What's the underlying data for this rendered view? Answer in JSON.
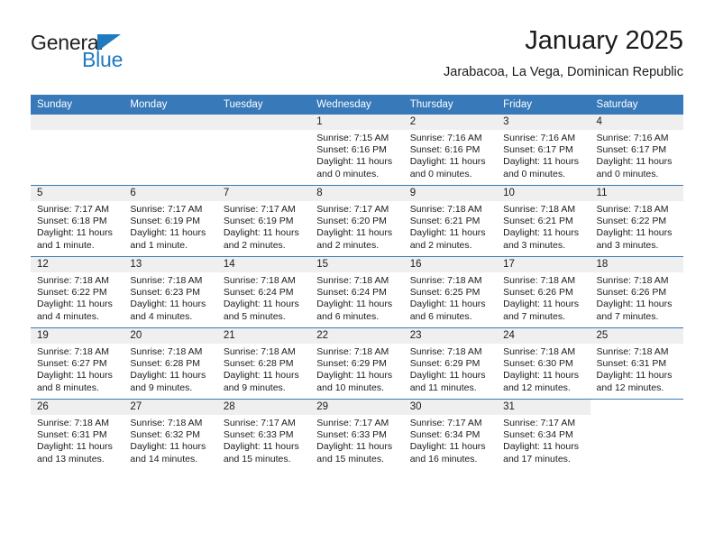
{
  "brand": {
    "name_top": "General",
    "name_bottom": "Blue",
    "accent_color": "#1f7ac0"
  },
  "header": {
    "title": "January 2025",
    "subtitle": "Jarabacoa, La Vega, Dominican Republic"
  },
  "calendar": {
    "header_bg": "#3779b9",
    "daynum_bg": "#efefef",
    "weekday_headers": [
      "Sunday",
      "Monday",
      "Tuesday",
      "Wednesday",
      "Thursday",
      "Friday",
      "Saturday"
    ],
    "labels": {
      "sunrise": "Sunrise:",
      "sunset": "Sunset:",
      "daylight": "Daylight:"
    },
    "weeks": [
      [
        {
          "day": "",
          "empty": true
        },
        {
          "day": "",
          "empty": true
        },
        {
          "day": "",
          "empty": true
        },
        {
          "day": "1",
          "sunrise": "Sunrise: 7:15 AM",
          "sunset": "Sunset: 6:16 PM",
          "daylight_line1": "Daylight: 11 hours",
          "daylight_line2": "and 0 minutes."
        },
        {
          "day": "2",
          "sunrise": "Sunrise: 7:16 AM",
          "sunset": "Sunset: 6:16 PM",
          "daylight_line1": "Daylight: 11 hours",
          "daylight_line2": "and 0 minutes."
        },
        {
          "day": "3",
          "sunrise": "Sunrise: 7:16 AM",
          "sunset": "Sunset: 6:17 PM",
          "daylight_line1": "Daylight: 11 hours",
          "daylight_line2": "and 0 minutes."
        },
        {
          "day": "4",
          "sunrise": "Sunrise: 7:16 AM",
          "sunset": "Sunset: 6:17 PM",
          "daylight_line1": "Daylight: 11 hours",
          "daylight_line2": "and 0 minutes."
        }
      ],
      [
        {
          "day": "5",
          "sunrise": "Sunrise: 7:17 AM",
          "sunset": "Sunset: 6:18 PM",
          "daylight_line1": "Daylight: 11 hours",
          "daylight_line2": "and 1 minute."
        },
        {
          "day": "6",
          "sunrise": "Sunrise: 7:17 AM",
          "sunset": "Sunset: 6:19 PM",
          "daylight_line1": "Daylight: 11 hours",
          "daylight_line2": "and 1 minute."
        },
        {
          "day": "7",
          "sunrise": "Sunrise: 7:17 AM",
          "sunset": "Sunset: 6:19 PM",
          "daylight_line1": "Daylight: 11 hours",
          "daylight_line2": "and 2 minutes."
        },
        {
          "day": "8",
          "sunrise": "Sunrise: 7:17 AM",
          "sunset": "Sunset: 6:20 PM",
          "daylight_line1": "Daylight: 11 hours",
          "daylight_line2": "and 2 minutes."
        },
        {
          "day": "9",
          "sunrise": "Sunrise: 7:18 AM",
          "sunset": "Sunset: 6:21 PM",
          "daylight_line1": "Daylight: 11 hours",
          "daylight_line2": "and 2 minutes."
        },
        {
          "day": "10",
          "sunrise": "Sunrise: 7:18 AM",
          "sunset": "Sunset: 6:21 PM",
          "daylight_line1": "Daylight: 11 hours",
          "daylight_line2": "and 3 minutes."
        },
        {
          "day": "11",
          "sunrise": "Sunrise: 7:18 AM",
          "sunset": "Sunset: 6:22 PM",
          "daylight_line1": "Daylight: 11 hours",
          "daylight_line2": "and 3 minutes."
        }
      ],
      [
        {
          "day": "12",
          "sunrise": "Sunrise: 7:18 AM",
          "sunset": "Sunset: 6:22 PM",
          "daylight_line1": "Daylight: 11 hours",
          "daylight_line2": "and 4 minutes."
        },
        {
          "day": "13",
          "sunrise": "Sunrise: 7:18 AM",
          "sunset": "Sunset: 6:23 PM",
          "daylight_line1": "Daylight: 11 hours",
          "daylight_line2": "and 4 minutes."
        },
        {
          "day": "14",
          "sunrise": "Sunrise: 7:18 AM",
          "sunset": "Sunset: 6:24 PM",
          "daylight_line1": "Daylight: 11 hours",
          "daylight_line2": "and 5 minutes."
        },
        {
          "day": "15",
          "sunrise": "Sunrise: 7:18 AM",
          "sunset": "Sunset: 6:24 PM",
          "daylight_line1": "Daylight: 11 hours",
          "daylight_line2": "and 6 minutes."
        },
        {
          "day": "16",
          "sunrise": "Sunrise: 7:18 AM",
          "sunset": "Sunset: 6:25 PM",
          "daylight_line1": "Daylight: 11 hours",
          "daylight_line2": "and 6 minutes."
        },
        {
          "day": "17",
          "sunrise": "Sunrise: 7:18 AM",
          "sunset": "Sunset: 6:26 PM",
          "daylight_line1": "Daylight: 11 hours",
          "daylight_line2": "and 7 minutes."
        },
        {
          "day": "18",
          "sunrise": "Sunrise: 7:18 AM",
          "sunset": "Sunset: 6:26 PM",
          "daylight_line1": "Daylight: 11 hours",
          "daylight_line2": "and 7 minutes."
        }
      ],
      [
        {
          "day": "19",
          "sunrise": "Sunrise: 7:18 AM",
          "sunset": "Sunset: 6:27 PM",
          "daylight_line1": "Daylight: 11 hours",
          "daylight_line2": "and 8 minutes."
        },
        {
          "day": "20",
          "sunrise": "Sunrise: 7:18 AM",
          "sunset": "Sunset: 6:28 PM",
          "daylight_line1": "Daylight: 11 hours",
          "daylight_line2": "and 9 minutes."
        },
        {
          "day": "21",
          "sunrise": "Sunrise: 7:18 AM",
          "sunset": "Sunset: 6:28 PM",
          "daylight_line1": "Daylight: 11 hours",
          "daylight_line2": "and 9 minutes."
        },
        {
          "day": "22",
          "sunrise": "Sunrise: 7:18 AM",
          "sunset": "Sunset: 6:29 PM",
          "daylight_line1": "Daylight: 11 hours",
          "daylight_line2": "and 10 minutes."
        },
        {
          "day": "23",
          "sunrise": "Sunrise: 7:18 AM",
          "sunset": "Sunset: 6:29 PM",
          "daylight_line1": "Daylight: 11 hours",
          "daylight_line2": "and 11 minutes."
        },
        {
          "day": "24",
          "sunrise": "Sunrise: 7:18 AM",
          "sunset": "Sunset: 6:30 PM",
          "daylight_line1": "Daylight: 11 hours",
          "daylight_line2": "and 12 minutes."
        },
        {
          "day": "25",
          "sunrise": "Sunrise: 7:18 AM",
          "sunset": "Sunset: 6:31 PM",
          "daylight_line1": "Daylight: 11 hours",
          "daylight_line2": "and 12 minutes."
        }
      ],
      [
        {
          "day": "26",
          "sunrise": "Sunrise: 7:18 AM",
          "sunset": "Sunset: 6:31 PM",
          "daylight_line1": "Daylight: 11 hours",
          "daylight_line2": "and 13 minutes."
        },
        {
          "day": "27",
          "sunrise": "Sunrise: 7:18 AM",
          "sunset": "Sunset: 6:32 PM",
          "daylight_line1": "Daylight: 11 hours",
          "daylight_line2": "and 14 minutes."
        },
        {
          "day": "28",
          "sunrise": "Sunrise: 7:17 AM",
          "sunset": "Sunset: 6:33 PM",
          "daylight_line1": "Daylight: 11 hours",
          "daylight_line2": "and 15 minutes."
        },
        {
          "day": "29",
          "sunrise": "Sunrise: 7:17 AM",
          "sunset": "Sunset: 6:33 PM",
          "daylight_line1": "Daylight: 11 hours",
          "daylight_line2": "and 15 minutes."
        },
        {
          "day": "30",
          "sunrise": "Sunrise: 7:17 AM",
          "sunset": "Sunset: 6:34 PM",
          "daylight_line1": "Daylight: 11 hours",
          "daylight_line2": "and 16 minutes."
        },
        {
          "day": "31",
          "sunrise": "Sunrise: 7:17 AM",
          "sunset": "Sunset: 6:34 PM",
          "daylight_line1": "Daylight: 11 hours",
          "daylight_line2": "and 17 minutes."
        },
        {
          "day": "",
          "empty": true,
          "blank": true
        }
      ]
    ]
  }
}
